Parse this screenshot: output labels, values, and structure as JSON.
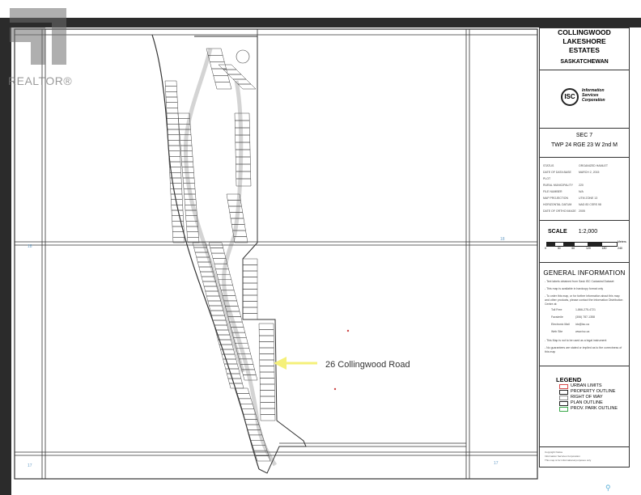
{
  "watermark": {
    "text": "REALTOR®"
  },
  "callout": {
    "label": "26 Collingwood Road",
    "arrow_color": "#f5f07a"
  },
  "title_block": {
    "line1": "COLLINGWOOD",
    "line2": "LAKESHORE",
    "line3": "ESTATES",
    "province": "SASKATCHEWAN"
  },
  "logo": {
    "mark": "ISC",
    "line1": "Information",
    "line2": "Services",
    "line3": "Corporation"
  },
  "section": {
    "sec": "SEC 7",
    "twp": "TWP 24 RGE 23 W 2nd M"
  },
  "status_table": [
    {
      "k": "STATUS",
      "v": "ORGANIZED HAMLET"
    },
    {
      "k": "DATE OF DATA BASE PLOT",
      "v": "MARCH 2, 2015"
    },
    {
      "k": "RURAL MUNICIPALITY",
      "v": "220"
    },
    {
      "k": "FILE NUMBER",
      "v": "N/A"
    },
    {
      "k": "MAP PROJECTION",
      "v": "UTM ZONE 13"
    },
    {
      "k": "HORIZONTAL DATUM",
      "v": "NAD 83 CSRS 98"
    },
    {
      "k": "DATE OF ORTHO IMAGE",
      "v": "2005"
    }
  ],
  "scale": {
    "label": "SCALE",
    "ratio": "1:2,000",
    "unit": "Meters",
    "ticks": [
      "0",
      "30",
      "60",
      "120",
      "180",
      "240"
    ]
  },
  "general": {
    "title": "GENERAL INFORMATION",
    "p1": "- Text labels obtained from Sask ISC Cadastral Dataset",
    "p2": "- This map is available in hardcopy format only",
    "p3": "- To order this map, or for further information about this map and other products, please contact the Information Distribution Centre at:",
    "contacts": [
      {
        "k": "Toll Free",
        "v": "1-866-275-4721"
      },
      {
        "k": "Facsimile",
        "v": "(306) 787-1358"
      },
      {
        "k": "Electronic Mail",
        "v": "idc@isc.ca"
      },
      {
        "k": "Web Site",
        "v": "www.isc.ca"
      }
    ],
    "p4": "- This Map is not to be used as a legal instrument",
    "p5": "- No guarantees are stated or implied as to the correctness of this map"
  },
  "legend": {
    "title": "LEGEND",
    "items": [
      {
        "label": "URBAN LIMITS",
        "color": "#d94a4a"
      },
      {
        "label": "PROPERTY OUTLINE",
        "color": "#222222"
      },
      {
        "label": "RIGHT OF WAY",
        "color": "#888888"
      },
      {
        "label": "PLAN OUTLINE",
        "color": "#222222"
      },
      {
        "label": "PROV. PARK OUTLINE",
        "color": "#3aa84a"
      }
    ]
  },
  "footer": {
    "line1": "Copyright Notice",
    "line2": "Information Services Corporation",
    "line3": "This map is for informational purposes only"
  },
  "colors": {
    "parcel": "#444444",
    "road_label": "#c44444",
    "dark_bar": "#2b2b2b"
  }
}
